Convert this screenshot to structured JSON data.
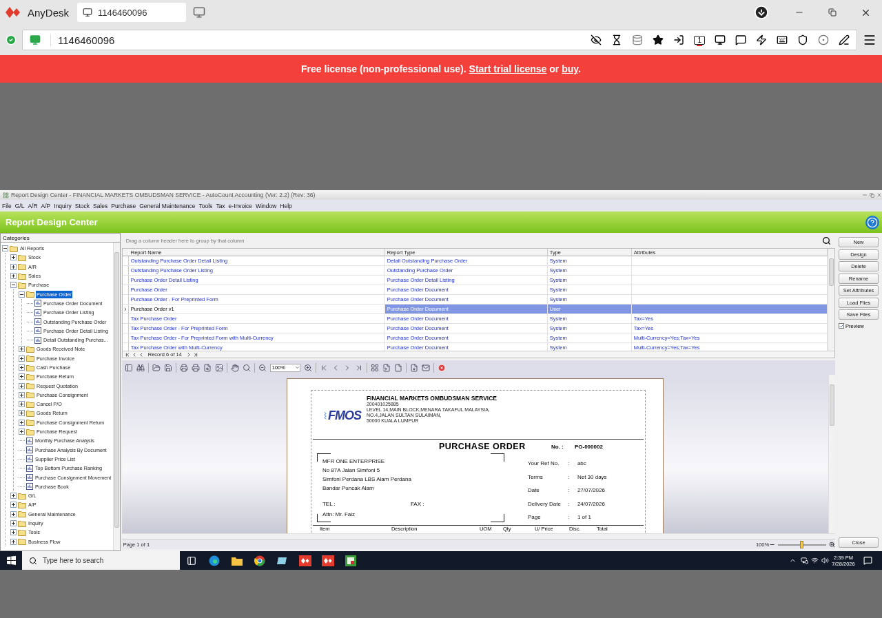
{
  "anydesk": {
    "app_name": "AnyDesk",
    "tab_label": "1146460096",
    "address": "1146460096",
    "display_number": "1",
    "banner": {
      "text": "Free license (non-professional use).",
      "link_trial": "Start trial license",
      "or": "or",
      "link_buy": "buy",
      "end": "."
    }
  },
  "window": {
    "title": "Report Design Center - FINANCIAL MARKETS OMBUDSMAN SERVICE - AutoCount Accounting (Ver: 2.2) (Rev: 36)"
  },
  "menu": [
    "File",
    "G/L",
    "A/R",
    "A/P",
    "Inquiry",
    "Stock",
    "Sales",
    "Purchase",
    "General Maintenance",
    "Tools",
    "Tax",
    "e-Invoice",
    "Window",
    "Help"
  ],
  "header": {
    "title": "Report Design Center"
  },
  "tree": {
    "heading": "Categories",
    "items": [
      {
        "label": "All Reports",
        "kind": "folder",
        "expanded": true,
        "selected": false,
        "children": [
          {
            "label": "Stock",
            "kind": "folder",
            "expanded": false,
            "selected": false
          },
          {
            "label": "A/R",
            "kind": "folder",
            "expanded": false,
            "selected": false
          },
          {
            "label": "Sales",
            "kind": "folder",
            "expanded": false,
            "selected": false
          },
          {
            "label": "Purchase",
            "kind": "folder",
            "expanded": true,
            "selected": false,
            "children": [
              {
                "label": "Purchase Order",
                "kind": "folder",
                "expanded": true,
                "selected": true,
                "children": [
                  {
                    "label": "Purchase Order Document",
                    "kind": "report",
                    "selected": false
                  },
                  {
                    "label": "Purchase Order Listing",
                    "kind": "report",
                    "selected": false
                  },
                  {
                    "label": "Outstanding Purchase Order",
                    "kind": "report",
                    "selected": false
                  },
                  {
                    "label": "Purchase Order Detail Listing",
                    "kind": "report",
                    "selected": false
                  },
                  {
                    "label": "Detail Outstanding Purchas...",
                    "kind": "report",
                    "selected": false
                  }
                ]
              },
              {
                "label": "Goods Received Note",
                "kind": "folder",
                "expanded": false,
                "selected": false
              },
              {
                "label": "Purchase Invoice",
                "kind": "folder",
                "expanded": false,
                "selected": false
              },
              {
                "label": "Cash Purchase",
                "kind": "folder",
                "expanded": false,
                "selected": false
              },
              {
                "label": "Purchase Return",
                "kind": "folder",
                "expanded": false,
                "selected": false
              },
              {
                "label": "Request Quotation",
                "kind": "folder",
                "expanded": false,
                "selected": false
              },
              {
                "label": "Purchase Consignment",
                "kind": "folder",
                "expanded": false,
                "selected": false
              },
              {
                "label": "Cancel P/O",
                "kind": "folder",
                "expanded": false,
                "selected": false
              },
              {
                "label": "Goods Return",
                "kind": "folder",
                "expanded": false,
                "selected": false
              },
              {
                "label": "Purchase Consignment Return",
                "kind": "folder",
                "expanded": false,
                "selected": false
              },
              {
                "label": "Purchase Request",
                "kind": "folder",
                "expanded": false,
                "selected": false
              },
              {
                "label": "Monthly Purchase Analysis",
                "kind": "report",
                "selected": false
              },
              {
                "label": "Purchase Analysis By Document",
                "kind": "report",
                "selected": false
              },
              {
                "label": "Supplier Price List",
                "kind": "report",
                "selected": false
              },
              {
                "label": "Top Bottom Purchase Ranking",
                "kind": "report",
                "selected": false
              },
              {
                "label": "Purchase Consignment Movement",
                "kind": "report",
                "selected": false
              },
              {
                "label": "Purchase Book",
                "kind": "report",
                "selected": false
              }
            ]
          },
          {
            "label": "G/L",
            "kind": "folder",
            "expanded": false,
            "selected": false
          },
          {
            "label": "A/P",
            "kind": "folder",
            "expanded": false,
            "selected": false
          },
          {
            "label": "General Maintenance",
            "kind": "folder",
            "expanded": false,
            "selected": false
          },
          {
            "label": "Inquiry",
            "kind": "folder",
            "expanded": false,
            "selected": false
          },
          {
            "label": "Tools",
            "kind": "folder",
            "expanded": false,
            "selected": false
          },
          {
            "label": "Business Flow",
            "kind": "folder",
            "expanded": false,
            "selected": false
          }
        ]
      }
    ]
  },
  "grid": {
    "group_hint": "Drag a column header here to group by that column",
    "columns": [
      "Report Name",
      "Report Type",
      "Type",
      "Attributes"
    ],
    "rows": [
      {
        "cells": [
          "Outstanding Purchase Order Detail Listing",
          "Detail Outstanding Purchase Order",
          "System",
          ""
        ],
        "selected": false
      },
      {
        "cells": [
          "Outstanding Purchase Order Listing",
          "Outstanding Purchase Order",
          "System",
          ""
        ],
        "selected": false
      },
      {
        "cells": [
          "Purchase Order Detail Listing",
          "Purchase Order Detail Listing",
          "System",
          ""
        ],
        "selected": false
      },
      {
        "cells": [
          "Purchase Order",
          "Purchase Order Document",
          "System",
          ""
        ],
        "selected": false
      },
      {
        "cells": [
          "Purchase Order - For Preprinted Form",
          "Purchase Order Document",
          "System",
          ""
        ],
        "selected": false
      },
      {
        "cells": [
          "Purchase Order v1",
          "Purchase Order Document",
          "User",
          ""
        ],
        "selected": true
      },
      {
        "cells": [
          "Tax Purchase Order",
          "Purchase Order Document",
          "System",
          "Tax=Yes"
        ],
        "selected": false
      },
      {
        "cells": [
          "Tax Purchase Order - For Preprinted Form",
          "Purchase Order Document",
          "System",
          "Tax=Yes"
        ],
        "selected": false
      },
      {
        "cells": [
          "Tax Purchase Order - For Preprinted Form with Multi-Currency",
          "Purchase Order Document",
          "System",
          "Multi-Currency=Yes;Tax=Yes"
        ],
        "selected": false
      },
      {
        "cells": [
          "Tax Purchase Order with Multi-Currency",
          "Purchase Order Document",
          "System",
          "Multi-Currency=Yes;Tax=Yes"
        ],
        "selected": false
      }
    ],
    "navigator": "Record 6 of 14"
  },
  "preview_toolbar": {
    "zoom": "100%"
  },
  "document": {
    "logo": "FMOS",
    "company": "FINANCIAL MARKETS OMBUDSMAN SERVICE",
    "company_lines": [
      "200401025885",
      "LEVEL 14,MAIN BLOCK,MENARA TAKAFUL MALAYSIA,",
      "NO.4,JALAN SULTAN SULAIMAN,",
      "50000 KUALA LUMPUR"
    ],
    "title": "PURCHASE  ORDER",
    "number_label": "No.  :",
    "number": "PO-000002",
    "supplier_lines": [
      "MFR ONE ENTERPRISE",
      "No 87A Jalan Simfoni 5",
      "Simfoni Perdana LBS Alam Perdana",
      "Bandar Puncak Alam"
    ],
    "tel": "TEL  :",
    "fax": "FAX  :",
    "attn": "Attn:  Mr. Faiz",
    "fields": [
      {
        "label": "Your Ref No.",
        "colon": ":",
        "value": "abc"
      },
      {
        "label": "Terms",
        "colon": ":",
        "value": "Net 30 days"
      },
      {
        "label": "Date",
        "colon": ":",
        "value": "27/07/2026"
      },
      {
        "label": "Delivery Date",
        "colon": ":",
        "value": "24/07/2026"
      },
      {
        "label": "Page",
        "colon": ":",
        "value": "1 of 1"
      }
    ],
    "columns": [
      "Item",
      "Description",
      "UOM",
      "Qty",
      "U/ Price",
      "Disc.",
      "Total"
    ]
  },
  "status_bar": {
    "page": "Page 1 of 1",
    "zoom": "100%",
    "level": 0.5
  },
  "actions": [
    "New",
    "Design",
    "Delete",
    "Rename",
    "Set Attributes",
    "Load Files",
    "Save Files"
  ],
  "preview_option": {
    "label": "Preview",
    "checked": true
  },
  "close": "Close",
  "taskbar": {
    "search_placeholder": "Type here to search",
    "time": "2:39 PM",
    "date": "7/28/2026"
  }
}
